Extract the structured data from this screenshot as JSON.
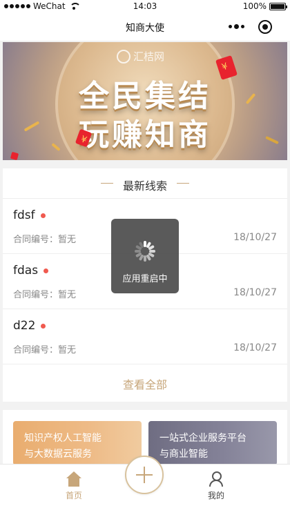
{
  "status_bar": {
    "carrier": "WeChat",
    "time": "14:03",
    "battery": "100%"
  },
  "nav": {
    "title": "知商大使"
  },
  "banner": {
    "logo_text": "汇桔网",
    "line1": "全民集结",
    "line2": "玩赚知商"
  },
  "leads": {
    "title": "最新线索",
    "items": [
      {
        "name": "fdsf",
        "contract": "合同编号：暂无",
        "date": "18/10/27"
      },
      {
        "name": "fdas",
        "contract": "合同编号：暂无",
        "date": "18/10/27"
      },
      {
        "name": "d22",
        "contract": "合同编号：暂无",
        "date": "18/10/27"
      }
    ],
    "view_all": "查看全部"
  },
  "cards": [
    {
      "line1": "知识产权人工智能",
      "line2": "与大数据云服务"
    },
    {
      "line1": "一站式企业服务平台",
      "line2": "与商业智能"
    }
  ],
  "tabs": {
    "home": "首页",
    "mine": "我的"
  },
  "toast": {
    "text": "应用重启中"
  },
  "colors": {
    "accent_gold": "#c7a67a",
    "unread_dot": "#f05a4f",
    "card1": "#eebb87",
    "card2": "#858399"
  }
}
